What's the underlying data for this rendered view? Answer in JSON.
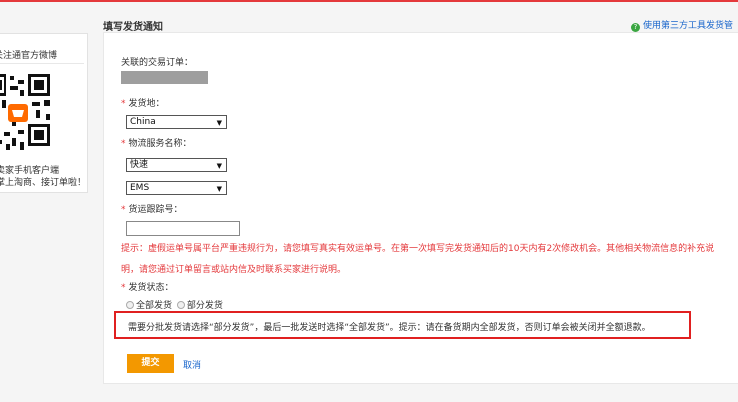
{
  "colors": {
    "accent": "#e4393c",
    "link": "#1a66cc",
    "submit_bg": "#f39800",
    "highlight_border": "#e02020"
  },
  "sidebar": {
    "follow_label": "关注通官方微博",
    "qr_label": "qr-code",
    "promo_line1": "卖家手机客户端",
    "promo_line2": "掌上淘商、接订单啦！"
  },
  "header": {
    "title": "填写发货通知",
    "help_icon": "question-icon",
    "help_link": "使用第三方工具发货管"
  },
  "form": {
    "order_label": "关联的交易订单：",
    "ship_from": {
      "label": "发货地：",
      "value": "China"
    },
    "logistics": {
      "label": "物流服务名称：",
      "type_value": "快速",
      "carrier_value": "EMS"
    },
    "tracking": {
      "label": "货运跟踪号：",
      "value": ""
    },
    "tip_line1": "提示：虚假运单号属平台严重违规行为，请您填写真实有效运单号。在第一次填写完发货通知后的10天内有2次修改机会。其他相关物流信息的补充说",
    "tip_line2": "明，请您通过订单留言或站内信及时联系买家进行说明。",
    "status": {
      "label": "发货状态：",
      "option_all": "全部发货",
      "option_partial": "部分发货"
    },
    "notice": "需要分批发货请选择“部分发货”，最后一批发送时选择“全部发货”。提示：请在备货期内全部发货，否则订单会被关闭并全额退款。",
    "submit_label": "提交",
    "cancel_label": "取消"
  }
}
